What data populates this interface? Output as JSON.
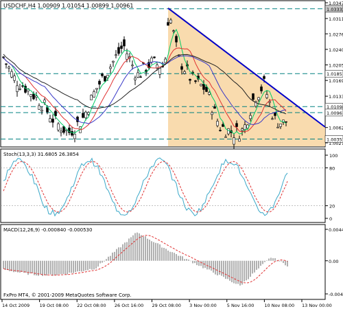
{
  "header": {
    "symbol_info": "USDCHF,H4  1.00909  1.01054  1.00899  1.00961"
  },
  "price_axis": {
    "ticks": [
      "1.03470",
      "1.03110",
      "1.02760",
      "1.02405",
      "1.02050",
      "1.01695",
      "1.01335",
      "1.00975",
      "1.00620",
      "1.00270"
    ],
    "tick_values": [
      1.0347,
      1.0311,
      1.0276,
      1.02405,
      1.0205,
      1.01695,
      1.01335,
      1.00975,
      1.0062,
      1.0027
    ],
    "flags": [
      {
        "text": "1.03332",
        "value": 1.03332,
        "color": "#c8c8c8"
      },
      {
        "text": "1.01851",
        "value": 1.01851,
        "color": "#ffffff"
      },
      {
        "text": "1.01098",
        "value": 1.01098,
        "color": "#ffffff"
      },
      {
        "text": "1.00961",
        "value": 1.00961,
        "color": "#ffffff"
      },
      {
        "text": "1.00357",
        "value": 1.00357,
        "color": "#ffffff"
      }
    ]
  },
  "stoch_panel": {
    "label": "Stoch(13,3,3) 31.6805 26.3854",
    "ticks": [
      "100",
      "80",
      "20",
      "0"
    ],
    "tick_values": [
      100,
      80,
      20,
      0
    ]
  },
  "macd_panel": {
    "label": "MACD(12,26,9) -0.000840 -0.000530",
    "ticks": [
      "0.00440",
      "0.00",
      "-0.00464"
    ],
    "tick_values": [
      0.0044,
      0,
      -0.00464
    ]
  },
  "time_axis": {
    "labels": [
      "14 Oct 2009",
      "19 Oct 08:00",
      "22 Oct 08:00",
      "26 Oct 16:00",
      "29 Oct 08:00",
      "3 Nov 00:00",
      "5 Nov 16:00",
      "10 Nov 08:00",
      "13 Nov 00:00"
    ]
  },
  "footer": {
    "copyright": "FxPro MT4, © 2001-2009 MetaQuotes Software Corp."
  },
  "colors": {
    "background": "#ffffff",
    "candles": "#000000",
    "triangle_fill": "#f8d5a0",
    "trendline": "#0000cc",
    "dashed_lines": "#008080",
    "ma_fast": "#00cc66",
    "ma_mid": "#e03030",
    "ma_slow": "#3838c8",
    "ma_long": "#202020",
    "stoch_main": "#3aa8c8",
    "stoch_signal": "#e03030",
    "macd_hist": "#b0b0b0",
    "macd_signal": "#e03030"
  }
}
